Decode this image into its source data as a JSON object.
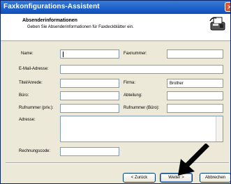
{
  "window": {
    "title": "Faxkonfigurations-Assistent",
    "close_symbol": "×"
  },
  "header": {
    "title": "Absenderinformationen",
    "subtitle": "Geben Sie Absenderinformationen für Faxdeckblätter ein.",
    "icon": "fax-machine-icon"
  },
  "form": {
    "name_label": "Name:",
    "name_value": "",
    "faxnummer_label": "Faxnummer:",
    "faxnummer_value": "",
    "email_label": "E-Mail-Adresse:",
    "email_value": "",
    "titel_label": "Titel/Anrede:",
    "titel_value": "",
    "firma_label": "Firma:",
    "firma_value": "Brother",
    "buero_label": "Büro:",
    "buero_value": "",
    "abteilung_label": "Abteilung:",
    "abteilung_value": "",
    "rufnummer_priv_label": "Rufnummer (priv.):",
    "rufnummer_priv_value": "",
    "rufnummer_buero_label": "Rufnummer (Büro):",
    "rufnummer_buero_value": "",
    "adresse_label": "Adresse:",
    "adresse_value": "",
    "rechnungscode_label": "Rechnungscode:",
    "rechnungscode_value": ""
  },
  "buttons": {
    "back": "< Zurück",
    "next": "Weiter >",
    "cancel": "Abbrechen"
  }
}
